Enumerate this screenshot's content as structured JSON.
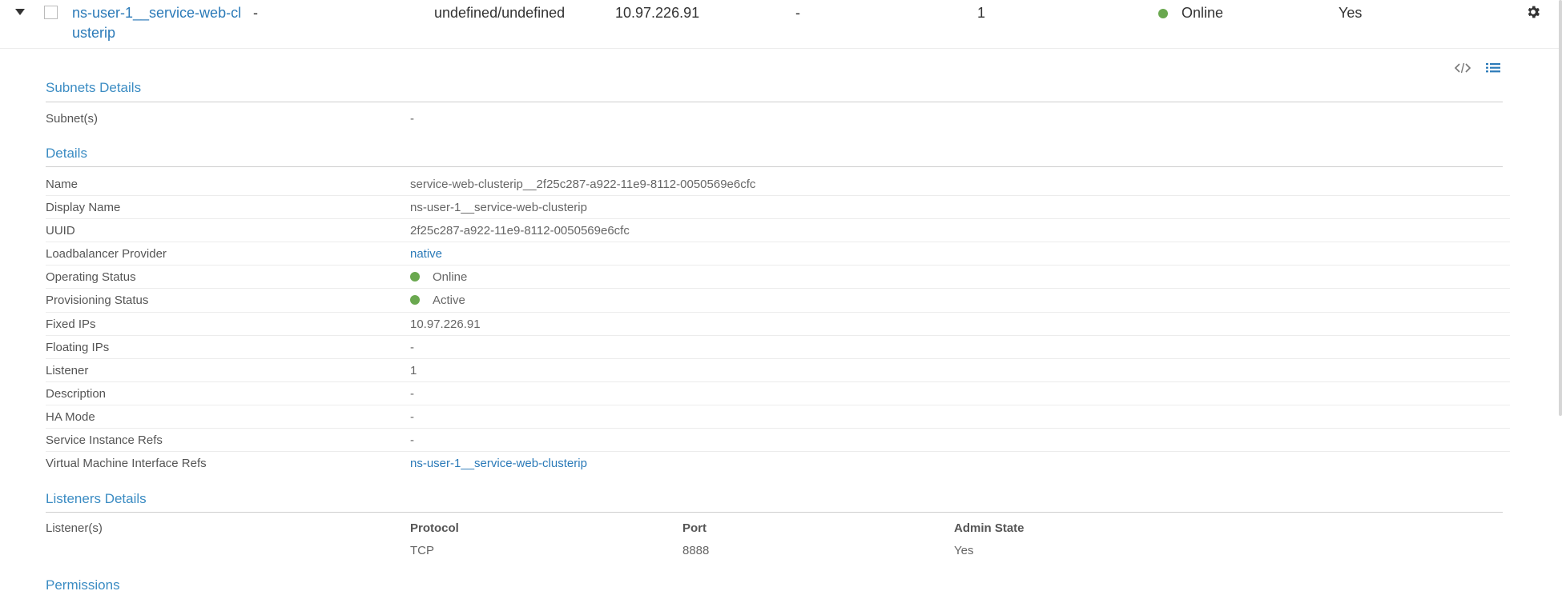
{
  "grid_row": {
    "name_line1": "ns-user-1__service-web-cl",
    "name_line2": "usterip",
    "dash1": "-",
    "project": "undefined/undefined",
    "fixed_ip": "10.97.226.91",
    "floating_ip": "-",
    "listeners": "1",
    "status": "Online",
    "admin_state": "Yes"
  },
  "toolbar": {
    "code_icon": "code-icon",
    "list_icon": "list-icon"
  },
  "subnets": {
    "title": "Subnets Details",
    "label": "Subnet(s)",
    "value": "-"
  },
  "details": {
    "title": "Details",
    "rows": [
      {
        "label": "Name",
        "value": "service-web-clusterip__2f25c287-a922-11e9-8112-0050569e6cfc"
      },
      {
        "label": "Display Name",
        "value": "ns-user-1__service-web-clusterip"
      },
      {
        "label": "UUID",
        "value": "2f25c287-a922-11e9-8112-0050569e6cfc"
      },
      {
        "label": "Loadbalancer Provider",
        "value": "native"
      },
      {
        "label": "Operating Status",
        "value": "Online"
      },
      {
        "label": "Provisioning Status",
        "value": "Active"
      },
      {
        "label": "Fixed IPs",
        "value": "10.97.226.91"
      },
      {
        "label": "Floating IPs",
        "value": "-"
      },
      {
        "label": "Listener",
        "value": "1"
      },
      {
        "label": "Description",
        "value": "-"
      },
      {
        "label": "HA Mode",
        "value": "-"
      },
      {
        "label": "Service Instance Refs",
        "value": "-"
      },
      {
        "label": "Virtual Machine Interface Refs",
        "value": "ns-user-1__service-web-clusterip"
      }
    ]
  },
  "listeners": {
    "title": "Listeners Details",
    "label": "Listener(s)",
    "headers": [
      "Protocol",
      "Port",
      "Admin State"
    ],
    "rows": [
      [
        "TCP",
        "8888",
        "Yes"
      ]
    ]
  },
  "permissions": {
    "title": "Permissions"
  },
  "colors": {
    "accent": "#2b7ab8",
    "status_green": "#6aa84f"
  }
}
